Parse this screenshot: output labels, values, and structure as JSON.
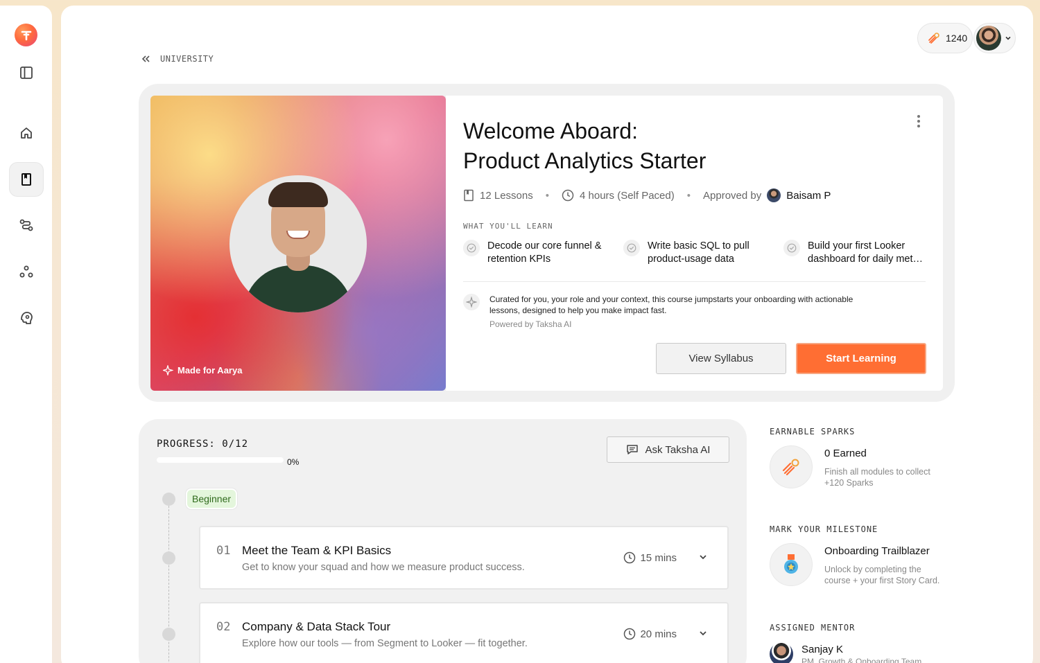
{
  "sparks": {
    "count": "1240"
  },
  "breadcrumb": {
    "label": "UNIVERSITY"
  },
  "hero": {
    "made_for": "Made for Aarya",
    "title_line1": "Welcome Aboard:",
    "title_line2": "Product Analytics Starter",
    "lessons": "12 Lessons",
    "duration": "4 hours (Self Paced)",
    "approved_label": "Approved by",
    "approver": "Baisam P",
    "learn_label": "WHAT YOU'LL LEARN",
    "learn_items": [
      "Decode our core funnel & retention KPIs",
      "Write basic SQL to pull product-usage data",
      "Build your first Looker dashboard for daily met…"
    ],
    "curated_text": "Curated for you, your role and your context, this course jumpstarts your onboarding with actionable lessons, designed to help you make impact fast.",
    "powered_by": "Powered by Taksha AI",
    "view_syllabus": "View Syllabus",
    "start_learning": "Start Learning"
  },
  "progress": {
    "label": "PROGRESS: 0/12",
    "completed": 0,
    "total": 12,
    "percent_label": "0%",
    "ask_label": "Ask Taksha AI",
    "level": "Beginner",
    "modules": [
      {
        "num": "01",
        "title": "Meet the Team & KPI Basics",
        "desc": "Get to know your squad and how we measure product success.",
        "duration": "15 mins"
      },
      {
        "num": "02",
        "title": "Company & Data Stack Tour",
        "desc": "Explore how our tools — from Segment to Looker — fit together.",
        "duration": "20 mins"
      }
    ]
  },
  "side": {
    "earnable_label": "EARNABLE SPARKS",
    "earned_title": "0 Earned",
    "earned_sub": "Finish all modules to collect +120 Sparks",
    "milestone_label": "MARK YOUR MILESTONE",
    "milestone_title": "Onboarding Trailblazer",
    "milestone_sub": "Unlock by completing the course + your first Story Card.",
    "mentor_label": "ASSIGNED MENTOR",
    "mentor_name": "Sanjay K",
    "mentor_role": "PM, Growth & Onboarding Team"
  },
  "colors": {
    "accent": "#ff6e33",
    "level_bg": "#e4f6dc",
    "level_text": "#2f6a1c"
  },
  "icons": [
    "logo-icon",
    "sidebar-toggle-icon",
    "home-icon",
    "book-icon",
    "route-icon",
    "community-icon",
    "mentor-icon",
    "sparks-icon",
    "chevron-down-icon",
    "double-chevron-left-icon",
    "kebab-icon",
    "clock-icon",
    "check-circle-icon",
    "sparkle-icon",
    "chat-icon",
    "medal-icon"
  ]
}
